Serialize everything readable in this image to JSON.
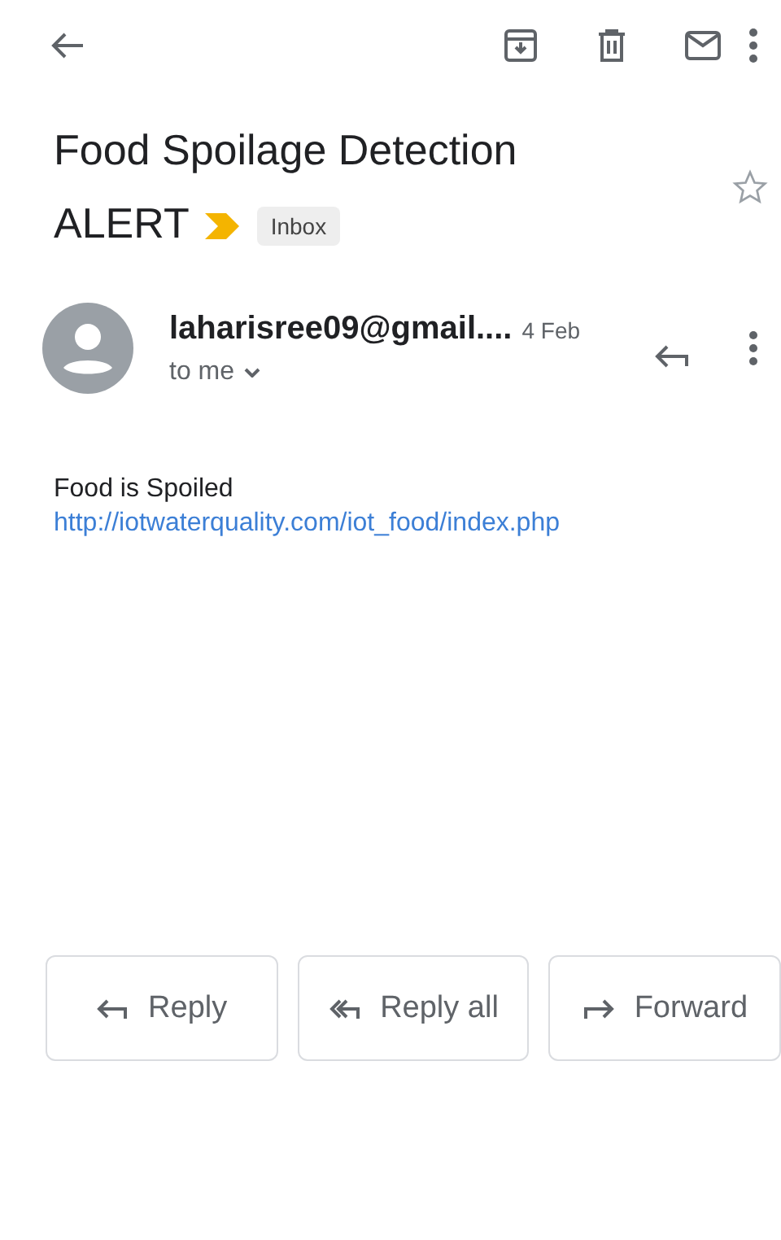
{
  "subject": {
    "lines": [
      "Food Spoilage Detection",
      "ALERT"
    ],
    "important": true,
    "label": "Inbox",
    "starred": false
  },
  "sender": {
    "name": "laharisree09@gmail....",
    "date": "4 Feb",
    "recipient": "to me"
  },
  "body": {
    "text": "Food is Spoiled",
    "link": "http://iotwaterquality.com/iot_food/index.php"
  },
  "actions": [
    {
      "kind": "reply",
      "label": "Reply"
    },
    {
      "kind": "reply-all",
      "label": "Reply all"
    },
    {
      "kind": "forward",
      "label": "Forward"
    }
  ]
}
